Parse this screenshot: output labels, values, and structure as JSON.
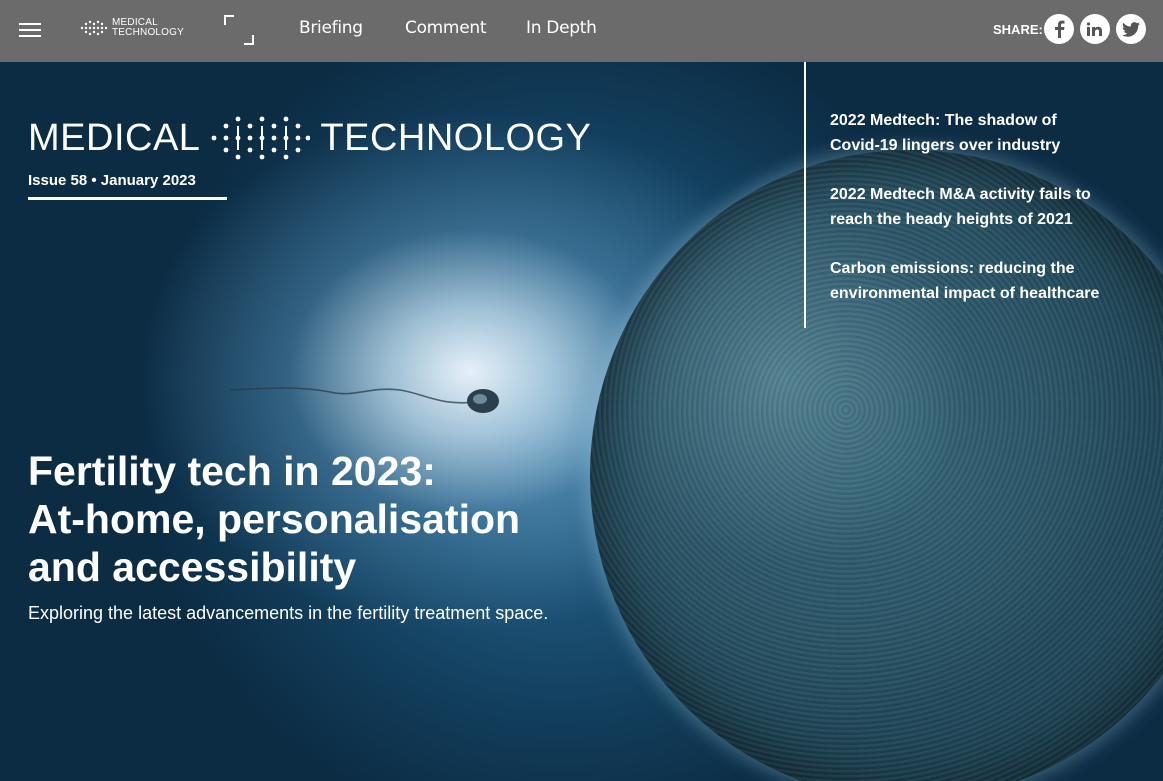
{
  "topbar": {
    "logo_line1": "MEDICAL",
    "logo_line2": "TECHNOLOGY",
    "nav": [
      "Briefing",
      "Comment",
      "In Depth"
    ],
    "share_label": "SHARE:",
    "share_icons": [
      "facebook-icon",
      "linkedin-icon",
      "twitter-icon"
    ]
  },
  "hero": {
    "masthead_left": "MEDICAL",
    "masthead_right": "TECHNOLOGY",
    "issue": "Issue 58 • January 2023",
    "headline_lines": [
      "Fertility tech in 2023:",
      "At-home, personalisation",
      "and accessibility"
    ],
    "subheadline": "Exploring the latest advancements in the fertility treatment space.",
    "side_links": [
      {
        "line1": "2022 Medtech: The shadow of",
        "line2": "Covid-19 lingers over industry"
      },
      {
        "line1": "2022 Medtech M&A activity fails to",
        "line2": "reach the heady heights of 2021"
      },
      {
        "line1": "Carbon emissions: reducing the",
        "line2": "environmental impact of healthcare"
      }
    ]
  },
  "colors": {
    "topbar": "#6b6b6b",
    "text": "#ffffff",
    "hero_dark": "#0f2d44"
  }
}
